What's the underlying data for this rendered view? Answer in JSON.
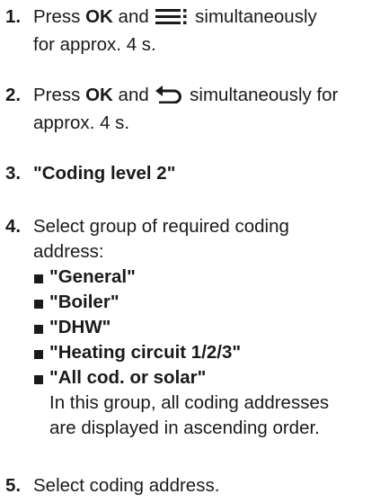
{
  "steps": [
    {
      "number": "1.",
      "parts": [
        "Press ",
        "OK",
        " and ",
        " simultaneously",
        "for approx. 4 s."
      ],
      "icon": "menu-icon"
    },
    {
      "number": "2.",
      "parts": [
        "Press ",
        "OK",
        " and ",
        " simultaneously for",
        "approx. 4 s."
      ],
      "icon": "back-arrow-icon"
    },
    {
      "number": "3.",
      "text": "\"Coding level 2\""
    },
    {
      "number": "4.",
      "lines": [
        "Select group of required coding",
        "address:"
      ],
      "options": [
        "\"General\"",
        "\"Boiler\"",
        "\"DHW\"",
        "\"Heating circuit 1/2/3\"",
        "\"All cod. or solar\""
      ],
      "note_lines": [
        "In this group, all coding addresses",
        "are displayed in ascending order."
      ]
    },
    {
      "number": "5.",
      "text": "Select coding address."
    }
  ]
}
